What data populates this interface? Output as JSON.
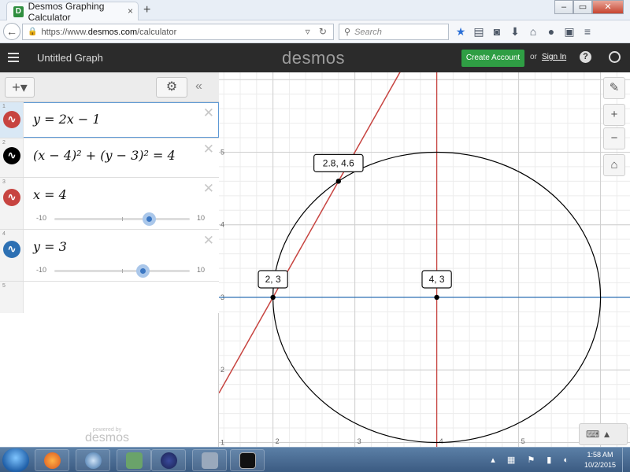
{
  "browser": {
    "tab_title": "Desmos Graphing Calculator",
    "tab_close": "×",
    "new_tab": "+",
    "url_prefix": "https://www.",
    "url_domain": "desmos.com",
    "url_path": "/calculator",
    "search_placeholder": "Search",
    "window_buttons": [
      "–",
      "▭",
      "✕"
    ]
  },
  "header": {
    "title": "Untitled Graph",
    "brand": "desmos",
    "create_account": "Create Account",
    "or": "or",
    "sign_in": "Sign In",
    "help": "?"
  },
  "toolbar": {
    "add": "+▾",
    "settings": "⚙",
    "collapse": "«"
  },
  "expressions": [
    {
      "num": "1",
      "latex": "y = 2x − 1",
      "color": "#c74440",
      "active": true
    },
    {
      "num": "2",
      "latex": "(x − 4)² + (y − 3)² = 4",
      "color": "#000000",
      "active": false
    },
    {
      "num": "3",
      "latex": "x = 4",
      "color": "#c74440",
      "active": false,
      "slider": {
        "min": "-10",
        "max": "10",
        "value": 4
      }
    },
    {
      "num": "4",
      "latex": "y = 3",
      "color": "#2d70b3",
      "active": false,
      "slider": {
        "min": "-10",
        "max": "10",
        "value": 3
      }
    },
    {
      "num": "5"
    }
  ],
  "powered_by": {
    "line1": "powered by",
    "line2": "desmos"
  },
  "graph": {
    "x_range": [
      1.34,
      6.36
    ],
    "y_range": [
      0.94,
      6.1
    ],
    "x_ticks": [
      "2",
      "3",
      "4",
      "5"
    ],
    "y_ticks": [
      "1",
      "2",
      "3",
      "4",
      "5"
    ],
    "line_color": "#c74440",
    "hline_color": "#2d70b3",
    "circle_color": "#000000",
    "points": [
      {
        "x": 2.8,
        "y": 4.6,
        "label": "2.8, 4.6"
      },
      {
        "x": 2,
        "y": 3,
        "label": "2, 3"
      },
      {
        "x": 4,
        "y": 3,
        "label": "4, 3"
      }
    ]
  },
  "graph_tools": {
    "wrench": "🔧",
    "zoom_in": "+",
    "zoom_out": "−",
    "home": "⌂",
    "keyboard": "⌨ ▲"
  },
  "taskbar": {
    "time": "1:58 AM",
    "date": "10/2/2015"
  }
}
